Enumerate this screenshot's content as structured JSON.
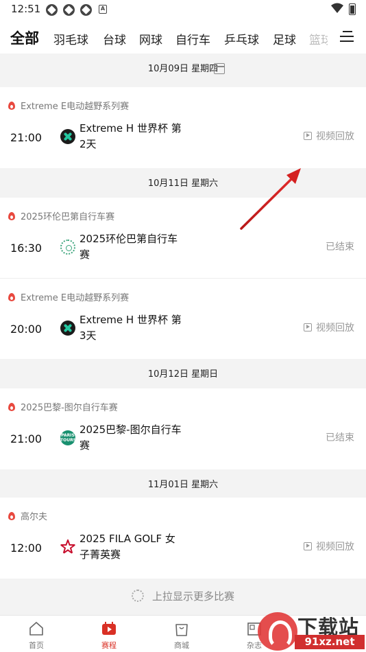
{
  "status_bar": {
    "time": "12:51",
    "badge_letter": "A"
  },
  "tabs": [
    "全部",
    "羽毛球",
    "台球",
    "网球",
    "自行车",
    "乒乓球",
    "足球",
    "篮球"
  ],
  "dates": [
    "10月09日 星期四",
    "10月11日 星期六",
    "10月12日 星期日",
    "11月01日 星期六"
  ],
  "events": [
    {
      "competition": "Extreme E电动越野系列赛",
      "time": "21:00",
      "title": "Extreme H 世界杯 第2天",
      "status": "视频回放",
      "logo": "extreme-logo-icon"
    },
    {
      "competition": "2025环伦巴第自行车赛",
      "time": "16:30",
      "title": "2025环伦巴第自行车赛",
      "status": "已结束",
      "logo": "tour-lombardy-logo-icon"
    },
    {
      "competition": "Extreme E电动越野系列赛",
      "time": "20:00",
      "title": "Extreme H 世界杯 第3天",
      "status": "视频回放",
      "logo": "extreme-logo-icon"
    },
    {
      "competition": "2025巴黎-图尔自行车赛",
      "time": "21:00",
      "title": "2025巴黎-图尔自行车赛",
      "status": "已结束",
      "logo": "paris-tours-logo-icon",
      "logo_text": "PARIS TOURS"
    },
    {
      "competition": "高尔夫",
      "time": "12:00",
      "title": "2025 FILA GOLF 女子菁英赛",
      "status": "视频回放",
      "logo": "fila-golf-logo-icon"
    }
  ],
  "load_more": "上拉显示更多比赛",
  "bottom_nav": [
    "首页",
    "赛程",
    "商城",
    "杂志"
  ],
  "watermark": {
    "text": "下载站",
    "url": "91xz.net"
  },
  "colors": {
    "accent": "#d93025",
    "hot": "#e8493f",
    "annotation_arrow": "#d42020"
  }
}
